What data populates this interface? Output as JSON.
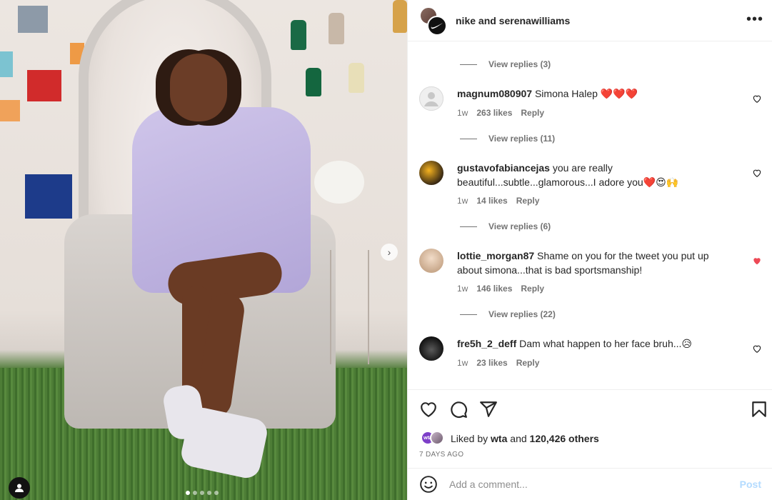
{
  "post": {
    "header_title": "nike and serenawilliams",
    "avatar_nike": "✓"
  },
  "comments": [
    {
      "view_replies": "View replies (3)"
    },
    {
      "user": "magnum080907",
      "text": "Simona Halep ❤️❤️❤️",
      "time": "1w",
      "likes": "263 likes",
      "reply": "Reply",
      "liked": false,
      "view_replies": "View replies (11)"
    },
    {
      "user": "gustavofabiancejas",
      "text": "you are really beautiful...subtle...glamorous...I adore you❤️😍🙌",
      "time": "1w",
      "likes": "14 likes",
      "reply": "Reply",
      "liked": false,
      "view_replies": "View replies (6)"
    },
    {
      "user": "lottie_morgan87",
      "text": "Shame on you for the tweet you put up about simona...that is bad sportsmanship!",
      "time": "1w",
      "likes": "146 likes",
      "reply": "Reply",
      "liked": true,
      "view_replies": "View replies (22)"
    },
    {
      "user": "fre5h_2_deff",
      "text": "Dam what happen to her face bruh...😥",
      "time": "1w",
      "likes": "23 likes",
      "reply": "Reply",
      "liked": false
    }
  ],
  "likes": {
    "prefix": "Liked by",
    "user": "wta",
    "joiner": "and",
    "others": "120,426 others",
    "wta_badge": "wta"
  },
  "date": "7 DAYS AGO",
  "add_comment": {
    "placeholder": "Add a comment...",
    "post_label": "Post"
  },
  "icons": {
    "more": "•••",
    "next": "›"
  },
  "colors": {
    "liked_heart": "#ed4956",
    "post_disabled": "#b3dbff",
    "secondary_text": "#737373"
  }
}
